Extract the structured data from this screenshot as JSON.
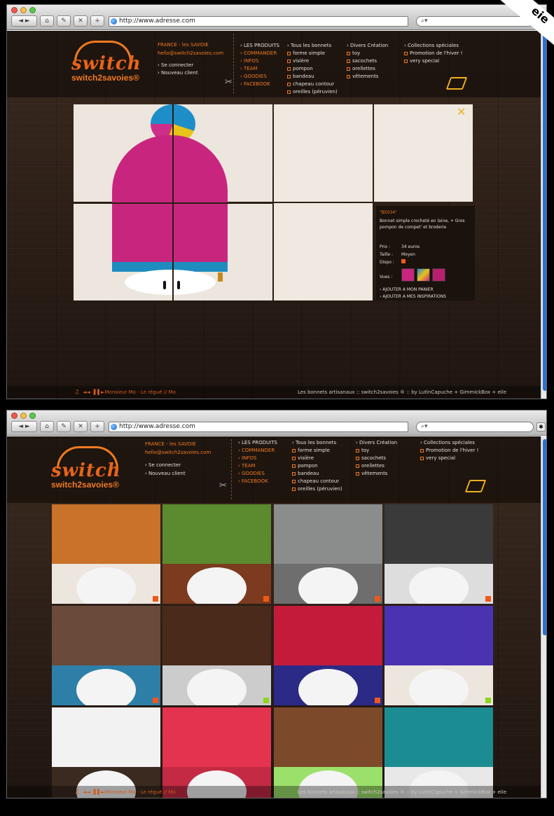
{
  "browser": {
    "url": "http://www.adresse.com",
    "search_icon": "search-icon",
    "nav_icons": [
      "back-forward-icon",
      "home-icon",
      "edit-icon",
      "stop-icon",
      "add-tab-icon"
    ]
  },
  "header": {
    "logo_word": "switch",
    "logo_sub": "switch2savoies®",
    "location": "FRANCE - les SAVOIE",
    "email": "hello@switch2savoies.com",
    "login": "› Se connecter",
    "new_client": "› Nouveau client"
  },
  "menu": {
    "main": [
      "› LES PRODUITS",
      "› COMMANDER",
      "› INFOS",
      "› TEAM",
      "› GOODIES",
      "› FACEBOOK"
    ],
    "bonnets_title": "› Tous les bonnets",
    "bonnets": [
      "forme simple",
      "visière",
      "pompon",
      "bandeau",
      "chapeau contour",
      "oreilles (péruvien)"
    ],
    "divers_title": "› Divers Création",
    "divers": [
      "toy",
      "sacochets",
      "orellettes",
      "vêtements"
    ],
    "collections_title": "› Collections spéciales",
    "collections": [
      "Promotion de l'hiver !",
      "very special"
    ]
  },
  "product": {
    "ref": "\"BS034\"",
    "desc_line1": "Bonnet simple crocheté en laine, + Gros",
    "desc_line2": "pompon de compet' et broderie",
    "price_label": "Prix :",
    "price_value": "34 euros",
    "size_label": "Taille :",
    "size_value": "Moyen",
    "dispo_label": "Dispo :",
    "views_label": "Vues :",
    "add_cart": "› AJOUTER A MON PANIER",
    "add_insp": "› AJOUTER A MES INSPIRATIONS"
  },
  "footer": {
    "player": "◄◄ ▐▐ ►Monsieur Mo - Le régué //  Mo",
    "player_icon": "speaker-icon",
    "credits": "Les bonnets artisanaux :: switch2savoies ® :: by LutinCapuche + GimmickBox + eile"
  },
  "colors": {
    "accent": "#f07a22",
    "available": "#f0581a",
    "new_badge": "#8ed61c"
  }
}
